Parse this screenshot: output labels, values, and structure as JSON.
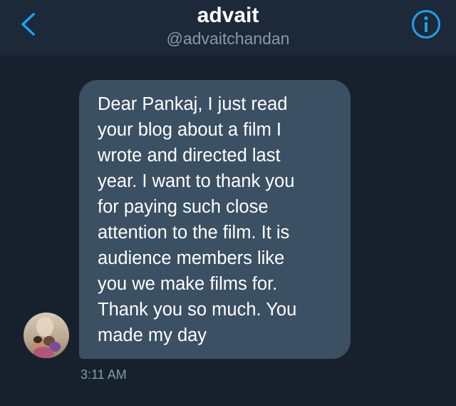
{
  "header": {
    "title": "advait",
    "handle": "@advaitchandan",
    "back_icon": "chevron-left-icon",
    "info_icon": "info-icon"
  },
  "conversation": {
    "message": {
      "text": "Dear Pankaj, I just read\nyour blog about a film I\nwrote and directed last\nyear. I want to thank you\nfor paying such close\nattention to the film. It is\naudience members like\nyou we make films for.\nThank you so much. You\nmade my day",
      "time": "3:11 AM"
    }
  },
  "colors": {
    "background": "#17212e",
    "header": "#1c2938",
    "bubble": "#3b5062",
    "accent": "#1da1f2",
    "muted": "#8899a6"
  }
}
